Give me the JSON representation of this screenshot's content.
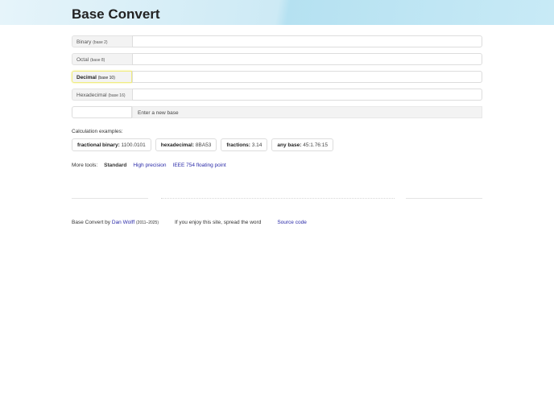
{
  "header": {
    "title": "Base Convert"
  },
  "fields": [
    {
      "name": "Binary",
      "base": "(base 2)",
      "value": ""
    },
    {
      "name": "Octal",
      "base": "(base 8)",
      "value": ""
    },
    {
      "name": "Decimal",
      "base": "(base 10)",
      "value": ""
    },
    {
      "name": "Hexadecimal",
      "base": "(base 16)",
      "value": ""
    }
  ],
  "new_base": {
    "value": "",
    "label": "Enter a new base"
  },
  "examples": {
    "title": "Calculation examples:",
    "items": [
      {
        "label": "fractional binary:",
        "value": "1100.0101"
      },
      {
        "label": "hexadecimal:",
        "value": "8BA53"
      },
      {
        "label": "fractions:",
        "value": "3.14"
      },
      {
        "label": "any base:",
        "value": "45:1.76:15"
      }
    ]
  },
  "tools": {
    "label": "More tools:",
    "current": "Standard",
    "links": [
      "High precision",
      "IEEE 754 floating point"
    ]
  },
  "footer": {
    "prefix": "Base Convert by",
    "author": "Dan Wolff",
    "years": "(2011–2025)",
    "share": "If you enjoy this site, spread the word",
    "source": "Source code"
  }
}
